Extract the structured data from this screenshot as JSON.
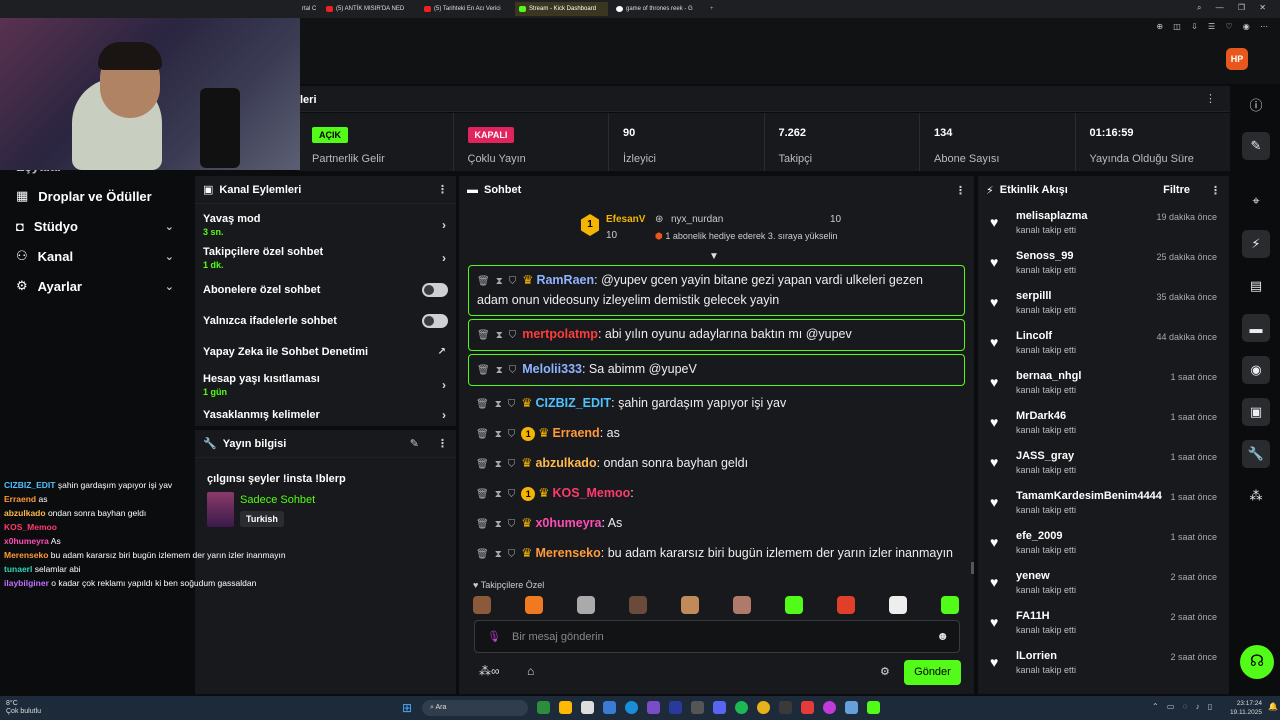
{
  "browser": {
    "tabs": [
      {
        "label": "rtal C"
      },
      {
        "label": "(5) ANTİK MISIR'DA NED"
      },
      {
        "label": "(5) Tarihteki En Acı Verici"
      },
      {
        "label": "Stream - Kick Dashboard"
      },
      {
        "label": "game of thrones reek - G"
      }
    ]
  },
  "sidebar": {
    "partial_label": "Eşyalar",
    "items": [
      {
        "label": "Droplar ve Ödüller",
        "icon": "gift-icon"
      },
      {
        "label": "Stüdyo",
        "icon": "studio-icon"
      },
      {
        "label": "Kanal",
        "icon": "channel-icon"
      },
      {
        "label": "Ayarlar",
        "icon": "gear-icon"
      }
    ]
  },
  "stats_header": {
    "partial_title": "leri"
  },
  "stats": [
    {
      "value": "AÇIK",
      "label": "Partnerlik Gelir"
    },
    {
      "value": "KAPALI",
      "label": "Çoklu Yayın"
    },
    {
      "value": "90",
      "label": "İzleyici"
    },
    {
      "value": "7.262",
      "label": "Takipçi"
    },
    {
      "value": "134",
      "label": "Abone Sayısı"
    },
    {
      "value": "01:16:59",
      "label": "Yayında Olduğu Süre"
    }
  ],
  "channel_actions": {
    "title": "Kanal Eylemleri",
    "items": [
      {
        "label": "Yavaş mod",
        "sub": "3 sn."
      },
      {
        "label": "Takipçilere özel sohbet",
        "sub": "1 dk."
      },
      {
        "label": "Abonelere özel sohbet"
      },
      {
        "label": "Yalnızca ifadelerle sohbet"
      },
      {
        "label": "Yapay Zeka ile Sohbet Denetimi"
      },
      {
        "label": "Hesap yaşı kısıtlaması",
        "sub": "1 gün"
      },
      {
        "label": "Yasaklanmış kelimeler"
      }
    ]
  },
  "stream_info": {
    "title": "Yayın bilgisi",
    "stream_title": "çılgınsı şeyler !insta !blerp",
    "category": "Sadece Sohbet",
    "tag": "Turkish"
  },
  "chat": {
    "title": "Sohbet",
    "pinned": {
      "user1": "EfesanV",
      "count1": "10",
      "user2": "nyx_nurdan",
      "count2": "10",
      "note": "1 abonelik hediye ederek 3. sıraya yükselin"
    },
    "messages": [
      {
        "user": "RamRaen",
        "color": "#8fb4ff",
        "text": ": @yupev gcen yayin bitane gezi yapan vardi ulkeleri gezen adam onun videosuny izleyelim demistik gelecek yayin",
        "hl": true
      },
      {
        "user": "mertpolatmp",
        "color": "#ff3b3b",
        "text": ": abi yılın oyunu adaylarına baktın mı @yupev",
        "hl": true
      },
      {
        "user": "Melolii333",
        "color": "#8fb4ff",
        "text": ": Sa abimm @yupeV",
        "hl": true
      },
      {
        "user": "CIZBIZ_EDIT",
        "color": "#4fc3ff",
        "text": ": şahin gardaşım yapıyor işi yav"
      },
      {
        "user": "Erraend",
        "color": "#ff9a3b",
        "text": ": as"
      },
      {
        "user": "abzulkado",
        "color": "#ffb84d",
        "text": ": ondan sonra bayhan geldı"
      },
      {
        "user": "KOS_Memoo",
        "color": "#ff3b6b",
        "text": ":"
      },
      {
        "user": "x0humeyra",
        "color": "#ff4db8",
        "text": ": As"
      },
      {
        "user": "Merenseko",
        "color": "#ff9a3b",
        "text": ": bu adam kararsız biri bugün izlemem der yarın izler inanmayın"
      },
      {
        "user": "tunaerl",
        "color": "#2fd5b8",
        "text": ": selamlar abi"
      },
      {
        "user": "ilaybilginer",
        "color": "#c070ff",
        "text": ": o kadar çok reklamı yapıldı ki ben soğudum gassaldan"
      }
    ],
    "emote_label": "Takipçilere Özel",
    "input_placeholder": "Bir mesaj gönderin",
    "send_label": "Gönder"
  },
  "events": {
    "title": "Etkinlik Akışı",
    "filter": "Filtre",
    "items": [
      {
        "name": "melisaplazma",
        "desc": "kanalı takip etti",
        "time": "19 dakika önce"
      },
      {
        "name": "Senoss_99",
        "desc": "kanalı takip etti",
        "time": "25 dakika önce"
      },
      {
        "name": "serpilll",
        "desc": "kanalı takip etti",
        "time": "35 dakika önce"
      },
      {
        "name": "Lincolf",
        "desc": "kanalı takip etti",
        "time": "44 dakika önce"
      },
      {
        "name": "bernaa_nhgl",
        "desc": "kanalı takip etti",
        "time": "1 saat önce"
      },
      {
        "name": "MrDark46",
        "desc": "kanalı takip etti",
        "time": "1 saat önce"
      },
      {
        "name": "JASS_gray",
        "desc": "kanalı takip etti",
        "time": "1 saat önce"
      },
      {
        "name": "TamamKardesimBenim4444",
        "desc": "kanalı takip etti",
        "time": "1 saat önce"
      },
      {
        "name": "efe_2009",
        "desc": "kanalı takip etti",
        "time": "1 saat önce"
      },
      {
        "name": "yenew",
        "desc": "kanalı takip etti",
        "time": "2 saat önce"
      },
      {
        "name": "FA11H",
        "desc": "kanalı takip etti",
        "time": "2 saat önce"
      },
      {
        "name": "lLorrien",
        "desc": "kanalı takip etti",
        "time": "2 saat önce"
      }
    ]
  },
  "overlay_chat": [
    {
      "user": "CIZBIZ_EDIT",
      "color": "#4fc3ff",
      "text": "şahin gardaşım yapıyor işi yav"
    },
    {
      "user": "Erraend",
      "color": "#ff9a3b",
      "text": "as"
    },
    {
      "user": "abzulkado",
      "color": "#ffb84d",
      "text": "ondan sonra bayhan geldı"
    },
    {
      "user": "KOS_Memoo",
      "color": "#ff3b6b",
      "text": ""
    },
    {
      "user": "x0humeyra",
      "color": "#ff4db8",
      "text": "As"
    },
    {
      "user": "Merenseko",
      "color": "#ff9a3b",
      "text": "bu adam kararsız biri bugün izlemem der yarın izler inanmayın"
    },
    {
      "user": "tunaerl",
      "color": "#2fd5b8",
      "text": "selamlar abi"
    },
    {
      "user": "ilaybilginer",
      "color": "#c070ff",
      "text": "o kadar çok reklamı yapıldı ki ben soğudum gassaldan"
    }
  ],
  "taskbar": {
    "weather_temp": "8°C",
    "weather_desc": "Çok bulutlu",
    "search": "Ara",
    "time": "23:17:24",
    "date": "19.11.2025"
  },
  "colors": {
    "accent": "#53fc18",
    "danger": "#e0245e",
    "panel": "#18191c"
  }
}
